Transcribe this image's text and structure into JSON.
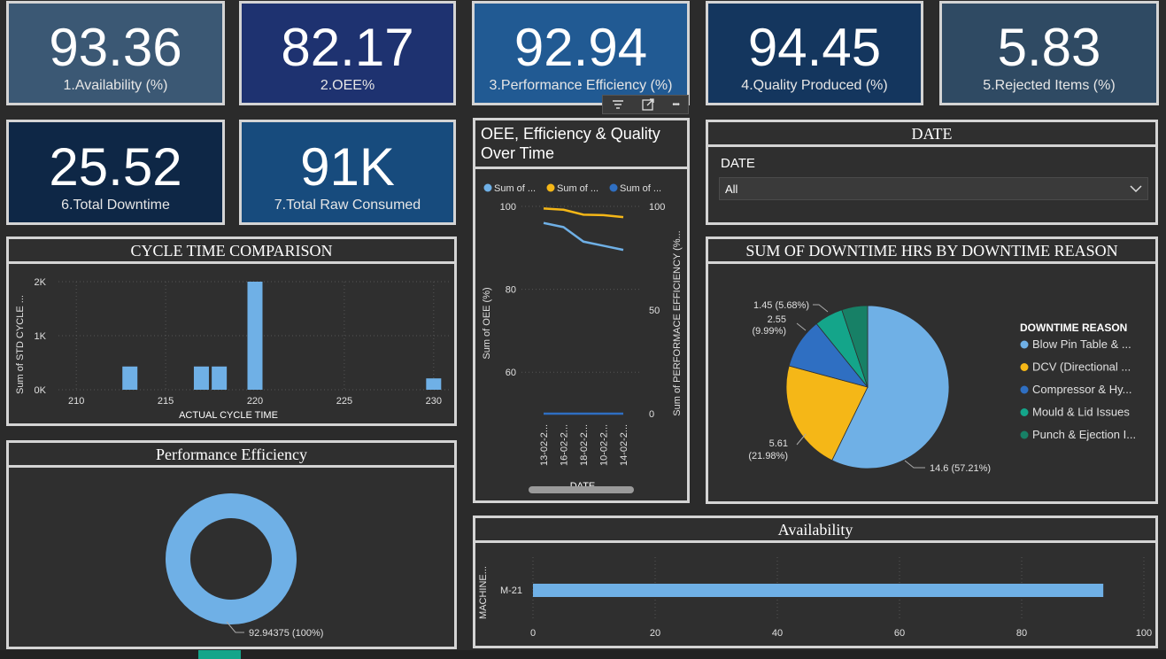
{
  "kpis": [
    {
      "value": "93.36",
      "label": "1.Availability (%)",
      "bg": "#3b5874"
    },
    {
      "value": "82.17",
      "label": "2.OEE%",
      "bg": "#1e3270"
    },
    {
      "value": "92.94",
      "label": "3.Performance Efficiency (%)",
      "bg": "#215a93"
    },
    {
      "value": "94.45",
      "label": "4.Quality Produced (%)",
      "bg": "#14365e"
    },
    {
      "value": "5.83",
      "label": "5.Rejected Items (%)",
      "bg": "#2f4a63"
    },
    {
      "value": "25.52",
      "label": "6.Total Downtime",
      "bg": "#0e2746"
    },
    {
      "value": "91K",
      "label": "7.Total Raw Consumed",
      "bg": "#174b7d"
    }
  ],
  "oee_panel": {
    "title": "OEE, Efficiency & Quality Over Time",
    "toolbar": {
      "filter_icon": "filter-icon",
      "focus_icon": "focus-mode-icon",
      "more_label": "•••"
    },
    "legend": [
      {
        "label": "Sum of ...",
        "color": "#6fb0e6"
      },
      {
        "label": "Sum of ...",
        "color": "#f5b717"
      },
      {
        "label": "Sum of ...",
        "color": "#2f6fc2"
      }
    ],
    "y_left_label": "Sum of OEE (%)",
    "y_right_label": "Sum of PERFORMACE EFFICIENCY (%...",
    "x_label": "DATE",
    "y_left_ticks": [
      "100",
      "80",
      "60"
    ],
    "y_right_ticks": [
      "100",
      "50",
      "0"
    ],
    "x_ticks": [
      "13-02-2...",
      "16-02-2...",
      "18-02-2...",
      "10-02-2...",
      "14-02-2..."
    ]
  },
  "date_slicer": {
    "title": "DATE",
    "label": "DATE",
    "selected": "All"
  },
  "cycle_panel": {
    "title": "CYCLE TIME COMPARISON"
  },
  "downtime_panel": {
    "title": "SUM OF DOWNTIME HRS BY DOWNTIME REASON",
    "legend_title": "DOWNTIME REASON",
    "legend": [
      {
        "label": "Blow Pin Table & ...",
        "color": "#6fb0e6"
      },
      {
        "label": "DCV (Directional ...",
        "color": "#f5b717"
      },
      {
        "label": "Compressor & Hy...",
        "color": "#2f6fc2"
      },
      {
        "label": "Mould & Lid Issues",
        "color": "#14a58a"
      },
      {
        "label": "Punch & Ejection I...",
        "color": "#178066"
      }
    ],
    "slice_labels": [
      "14.6 (57.21%)",
      "5.61",
      "(21.98%)",
      "2.55",
      "(9.99%)",
      "1.45 (5.68%)"
    ]
  },
  "perf_panel": {
    "title": "Performance Efficiency",
    "data_label": "92.94375 (100%)"
  },
  "avail_panel": {
    "title": "Availability",
    "y_label": "MACHINE...",
    "category": "M-21"
  },
  "chart_data": [
    {
      "type": "bar",
      "title": "CYCLE TIME COMPARISON",
      "xlabel": "ACTUAL CYCLE TIME",
      "ylabel": "Sum of STD CYCLE ...",
      "x": [
        213,
        217,
        218,
        220,
        230
      ],
      "values": [
        430,
        430,
        430,
        2000,
        210
      ],
      "xlim": [
        209,
        231
      ],
      "ylim": [
        0,
        2000
      ],
      "x_ticks": [
        "210",
        "215",
        "220",
        "225",
        "230"
      ],
      "y_ticks": [
        "0K",
        "1K",
        "2K"
      ],
      "color": "#6fb0e6",
      "grid": true
    },
    {
      "type": "line",
      "title": "OEE, Efficiency & Quality Over Time",
      "categories": [
        "13-02-2...",
        "16-02-2...",
        "18-02-2...",
        "10-02-2...",
        "14-02-2..."
      ],
      "series": [
        {
          "values": [
            96,
            95,
            91.5,
            90.5,
            89.5
          ],
          "color": "#6fb0e6",
          "axis": "left"
        },
        {
          "values": [
            99.5,
            99.2,
            98,
            97.9,
            97.4
          ],
          "color": "#f5b717",
          "axis": "left"
        },
        {
          "values": [
            0,
            0,
            0,
            0,
            0
          ],
          "color": "#2f6fc2",
          "axis": "right"
        }
      ],
      "ylim_left": [
        50,
        100
      ],
      "ylim_right": [
        0,
        100
      ]
    },
    {
      "type": "pie",
      "title": "SUM OF DOWNTIME HRS BY DOWNTIME REASON",
      "categories": [
        "Blow Pin Table & ...",
        "DCV (Directional ...",
        "Compressor & Hy...",
        "Mould & Lid Issues",
        "Punch & Ejection I..."
      ],
      "values": [
        14.6,
        5.61,
        2.55,
        1.45,
        1.31
      ],
      "colors": [
        "#6fb0e6",
        "#f5b717",
        "#2f6fc2",
        "#14a58a",
        "#178066"
      ]
    },
    {
      "type": "pie",
      "title": "Performance Efficiency",
      "categories": [
        "Performance Efficiency"
      ],
      "values": [
        92.94375
      ],
      "colors": [
        "#6fb0e6"
      ]
    },
    {
      "type": "bar",
      "title": "Availability",
      "orientation": "horizontal",
      "categories": [
        "M-21"
      ],
      "values": [
        93.36
      ],
      "xlim": [
        0,
        100
      ],
      "x_ticks": [
        "0",
        "20",
        "40",
        "60",
        "80",
        "100"
      ],
      "ylabel": "MACHINE...",
      "color": "#6fb0e6",
      "grid": true
    }
  ]
}
